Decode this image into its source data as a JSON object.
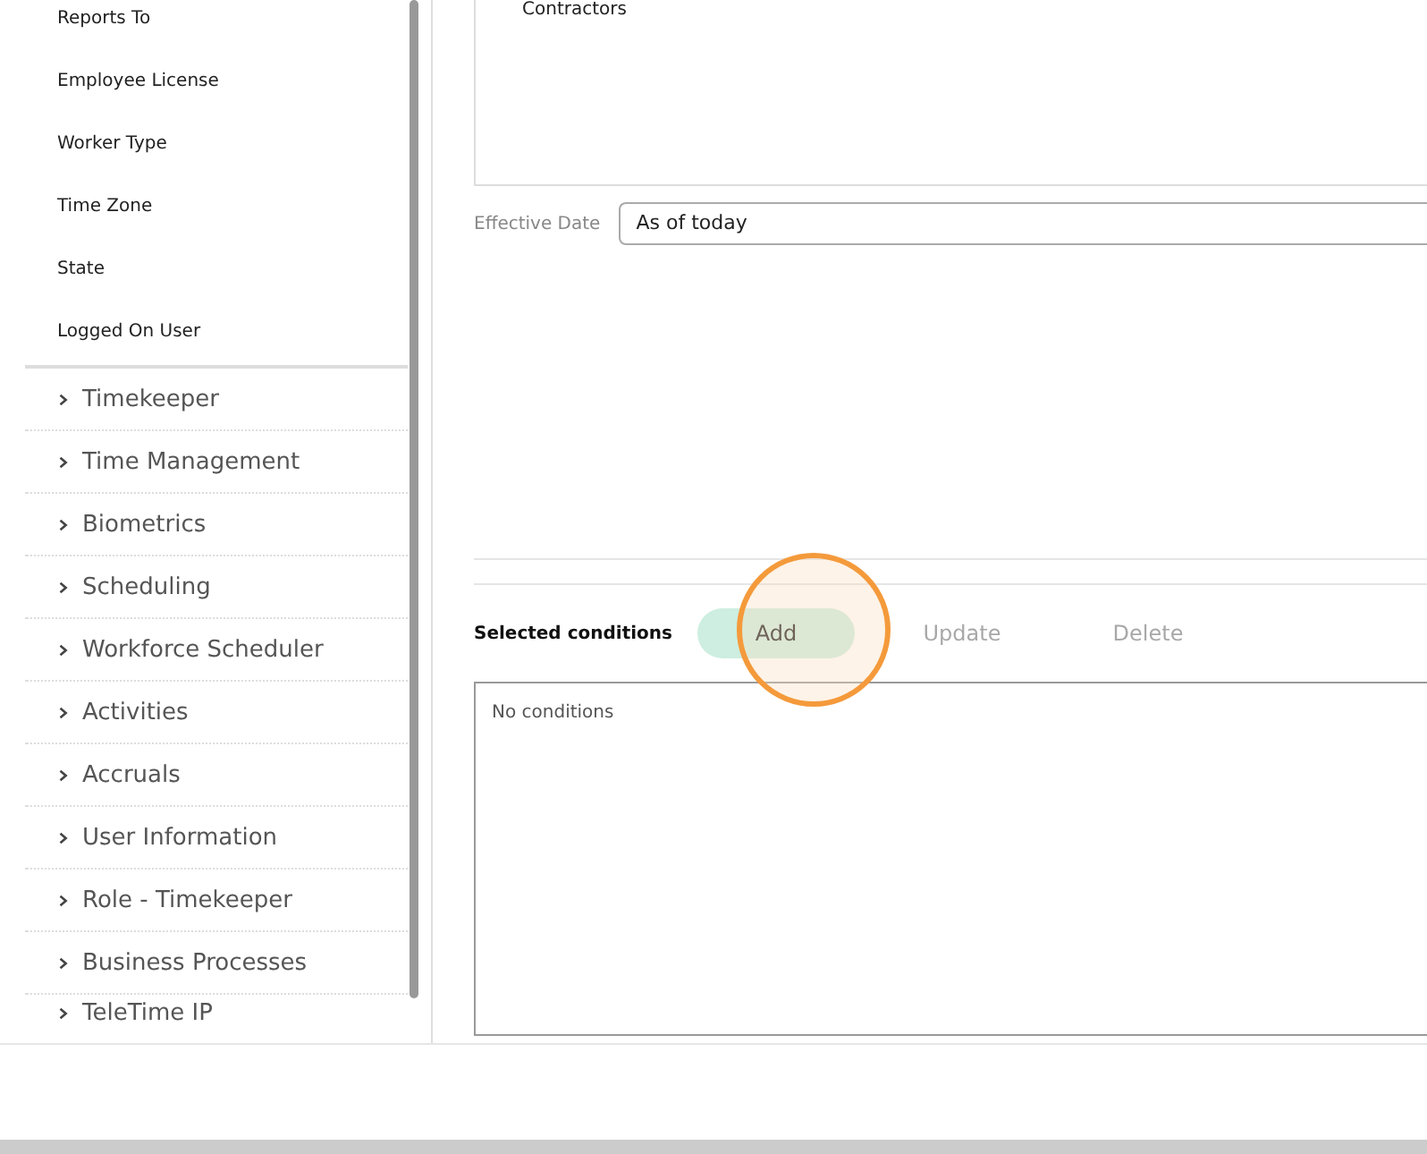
{
  "sidebar": {
    "fields": [
      {
        "label": "Reports To"
      },
      {
        "label": "Employee License"
      },
      {
        "label": "Worker Type"
      },
      {
        "label": "Time Zone"
      },
      {
        "label": "State"
      },
      {
        "label": "Logged On User"
      }
    ],
    "sections": [
      {
        "label": "Timekeeper",
        "expanded": false
      },
      {
        "label": "Time Management",
        "expanded": false
      },
      {
        "label": "Biometrics",
        "expanded": false
      },
      {
        "label": "Scheduling",
        "expanded": false
      },
      {
        "label": "Workforce Scheduler",
        "expanded": false
      },
      {
        "label": "Activities",
        "expanded": false
      },
      {
        "label": "Accruals",
        "expanded": false
      },
      {
        "label": "User Information",
        "expanded": false
      },
      {
        "label": "Role - Timekeeper",
        "expanded": false
      },
      {
        "label": "Business Processes",
        "expanded": false
      },
      {
        "label": "TeleTime IP",
        "expanded": false
      }
    ]
  },
  "main": {
    "list_items": [
      "Contractors"
    ],
    "effective_date": {
      "label": "Effective Date",
      "value": "As of today"
    },
    "conditions": {
      "title": "Selected conditions",
      "buttons": [
        {
          "label": "Add",
          "disabled": false,
          "highlighted": true
        },
        {
          "label": "Update",
          "disabled": true,
          "highlighted": false
        },
        {
          "label": "Delete",
          "disabled": true,
          "highlighted": false
        }
      ],
      "empty_text": "No conditions"
    }
  }
}
